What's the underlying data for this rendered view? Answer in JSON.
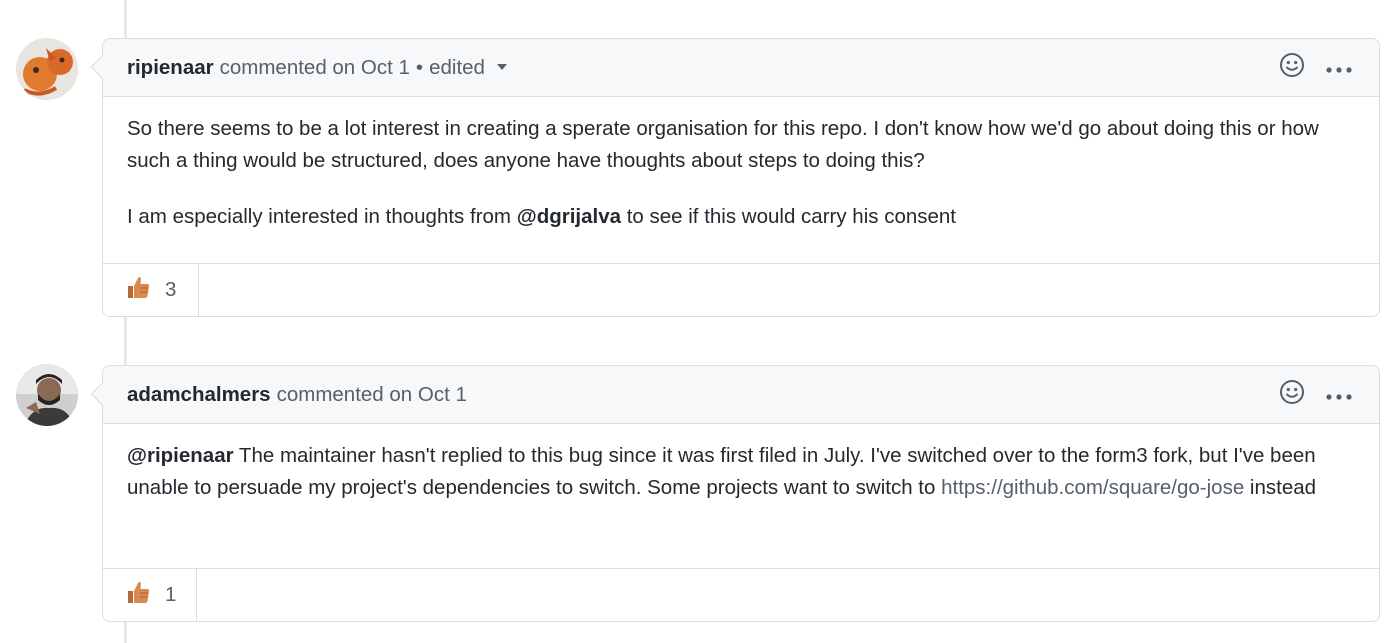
{
  "comments": [
    {
      "author": "ripienaar",
      "action": "commented on Oct 1",
      "edited_label": "edited",
      "paragraphs": [
        {
          "text": "So there seems to be a lot interest in creating a sperate organisation for this repo. I don't know how we'd go about doing this or how such a thing would be structured, does anyone have thoughts about steps to doing this?"
        },
        {
          "before": "I am especially interested in thoughts from ",
          "mention": "@dgrijalva",
          "after": " to see if this would carry his consent"
        }
      ],
      "reaction": {
        "icon": "thumbs-up-icon",
        "count": "3"
      }
    },
    {
      "author": "adamchalmers",
      "action": "commented on Oct 1",
      "body": {
        "mention": "@ripienaar",
        "text1": " The maintainer hasn't replied to this bug since it was first filed in July. I've switched over to the form3 fork, but I've been unable to persuade my project's dependencies to switch. Some projects want to switch to ",
        "link": "https://github.com/square/go-jose",
        "text2": " instead"
      },
      "reaction": {
        "icon": "thumbs-up-icon",
        "count": "1"
      }
    }
  ],
  "icons": {
    "emoji_picker": "smiley-icon",
    "more_options": "kebab-horizontal-icon"
  },
  "colors": {
    "border": "#d8dde2",
    "header_bg": "#f6f8fa",
    "muted_text": "#57606a",
    "text": "#24292f"
  }
}
